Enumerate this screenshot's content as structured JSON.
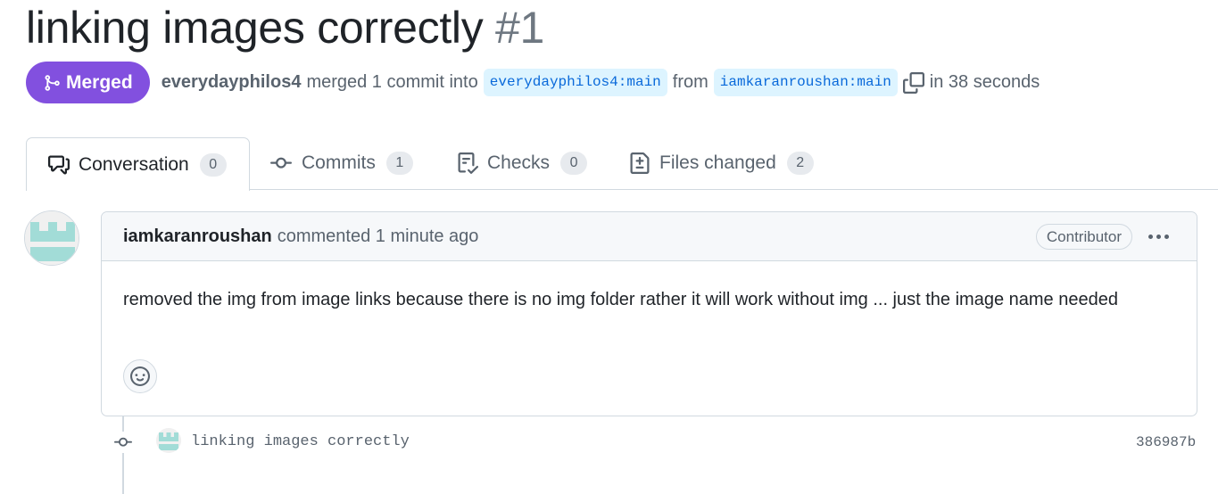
{
  "pr": {
    "title": "linking images correctly",
    "number": "#1",
    "status": "Merged",
    "merge_author": "everydayphilos4",
    "merge_text": "merged 1 commit into",
    "base_branch": "everydayphilos4:main",
    "from_text": "from",
    "head_branch": "iamkaranroushan:main",
    "duration": "in 38 seconds"
  },
  "tabs": [
    {
      "label": "Conversation",
      "count": "0",
      "icon": "comment-discussion-icon"
    },
    {
      "label": "Commits",
      "count": "1",
      "icon": "git-commit-icon"
    },
    {
      "label": "Checks",
      "count": "0",
      "icon": "checklist-icon"
    },
    {
      "label": "Files changed",
      "count": "2",
      "icon": "file-diff-icon"
    }
  ],
  "comment": {
    "author": "iamkaranroushan",
    "action": "commented 1 minute ago",
    "role": "Contributor",
    "body": "removed the img from image links because there is no img folder rather it will work without img ... just the image name needed"
  },
  "commit": {
    "message": "linking images correctly",
    "sha": "386987b"
  },
  "colors": {
    "merged": "#8250df",
    "branch_bg": "#ddf4ff",
    "branch_fg": "#0969da",
    "identicon": "#a2dcd7"
  }
}
